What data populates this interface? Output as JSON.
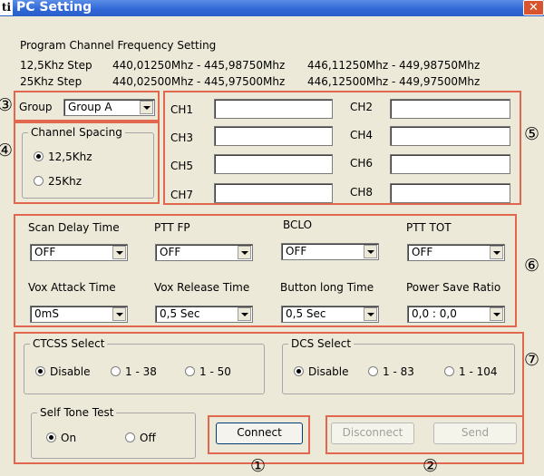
{
  "window": {
    "icon_text": "ti",
    "title": "PC Setting",
    "close_glyph": "✕"
  },
  "info": {
    "heading": "Program Channel Frequency Setting",
    "rows": [
      {
        "step": "12,5Khz Step",
        "range1": "440,01250Mhz - 445,98750Mhz",
        "range2": "446,11250Mhz - 449,98750Mhz"
      },
      {
        "step": "25Khz Step",
        "range1": "440,02500Mhz - 445,97500Mhz",
        "range2": "446,12500Mhz - 449,97500Mhz"
      }
    ]
  },
  "markers": {
    "m1": "①",
    "m2": "②",
    "m3": "③",
    "m4": "④",
    "m5": "⑤",
    "m6": "⑥",
    "m7": "⑦"
  },
  "group": {
    "label": "Group",
    "value": "Group A"
  },
  "channel_spacing": {
    "legend": "Channel Spacing",
    "options": [
      {
        "label": "12,5Khz",
        "selected": true
      },
      {
        "label": "25Khz",
        "selected": false
      }
    ]
  },
  "channels": [
    {
      "label": "CH1",
      "value": ""
    },
    {
      "label": "CH2",
      "value": ""
    },
    {
      "label": "CH3",
      "value": ""
    },
    {
      "label": "CH4",
      "value": ""
    },
    {
      "label": "CH5",
      "value": ""
    },
    {
      "label": "CH6",
      "value": ""
    },
    {
      "label": "CH7",
      "value": ""
    },
    {
      "label": "CH8",
      "value": ""
    }
  ],
  "settings": [
    {
      "label": "Scan Delay Time",
      "value": "OFF"
    },
    {
      "label": "PTT FP",
      "value": "OFF"
    },
    {
      "label": "BCLO",
      "value": "OFF"
    },
    {
      "label": "PTT TOT",
      "value": "OFF"
    },
    {
      "label": "Vox Attack Time",
      "value": "0mS"
    },
    {
      "label": "Vox Release Time",
      "value": "0,5 Sec"
    },
    {
      "label": "Button long Time",
      "value": "0,5 Sec"
    },
    {
      "label": "Power Save Ratio",
      "value": "0,0 : 0,0"
    }
  ],
  "ctcss": {
    "legend": "CTCSS Select",
    "options": [
      {
        "label": "Disable",
        "selected": true
      },
      {
        "label": "1 - 38",
        "selected": false
      },
      {
        "label": "1 - 50",
        "selected": false
      }
    ]
  },
  "dcs": {
    "legend": "DCS Select",
    "options": [
      {
        "label": "Disable",
        "selected": true
      },
      {
        "label": "1 - 83",
        "selected": false
      },
      {
        "label": "1 - 104",
        "selected": false
      }
    ]
  },
  "self_tone": {
    "legend": "Self Tone Test",
    "options": [
      {
        "label": "On",
        "selected": true
      },
      {
        "label": "Off",
        "selected": false
      }
    ]
  },
  "buttons": {
    "connect": "Connect",
    "disconnect": "Disconnect",
    "send": "Send"
  },
  "colors": {
    "annotation_red": "#e2674f",
    "window_bg": "#ece9d8",
    "titlebar_blue": "#2f66d6"
  }
}
